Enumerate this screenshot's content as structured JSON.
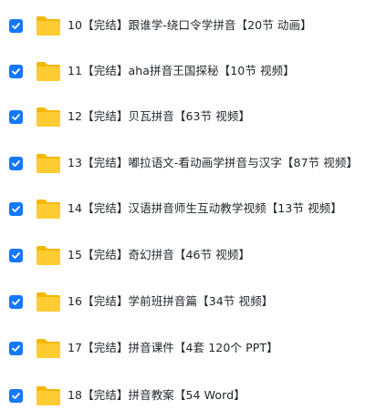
{
  "colors": {
    "checkbox": "#1677ff",
    "folder_front": "#ffcc33",
    "folder_back": "#f5b800",
    "text": "#1f2329"
  },
  "icons": {
    "checkbox": "checkbox-checked-icon",
    "folder": "folder-icon"
  },
  "items": [
    {
      "label": "10【完结】跟谁学-绕口令学拼音【20节 动画】",
      "checked": true
    },
    {
      "label": "11【完结】aha拼音王国探秘【10节 视频】",
      "checked": true
    },
    {
      "label": "12【完结】贝瓦拼音【63节 视频】",
      "checked": true
    },
    {
      "label": "13【完结】嘟拉语文-看动画学拼音与汉字【87节 视频】",
      "checked": true
    },
    {
      "label": "14【完结】汉语拼音师生互动教学视频【13节 视频】",
      "checked": true
    },
    {
      "label": "15【完结】奇幻拼音【46节 视频】",
      "checked": true
    },
    {
      "label": "16【完结】学前班拼音篇【34节 视频】",
      "checked": true
    },
    {
      "label": "17【完结】拼音课件【4套 120个 PPT】",
      "checked": true
    },
    {
      "label": "18【完结】拼音教案【54 Word】",
      "checked": true
    }
  ]
}
